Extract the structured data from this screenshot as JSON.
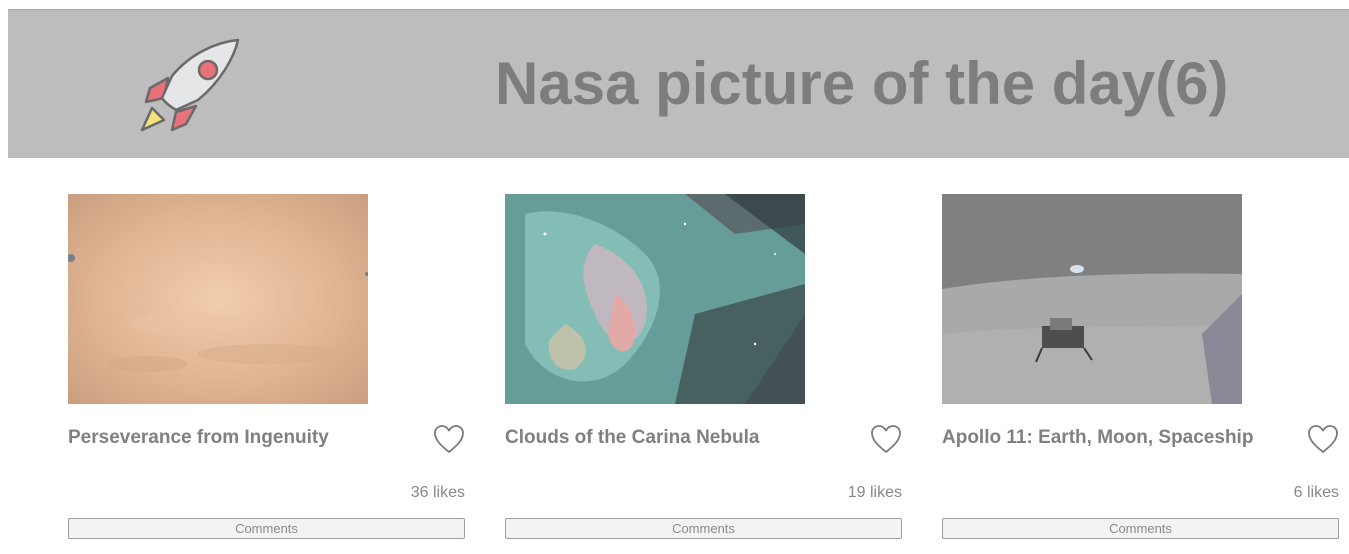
{
  "header": {
    "title": "Nasa picture of the day(6)",
    "logo_icon": "rocket-icon",
    "background": "#bdbdbd",
    "title_color": "#7d7d7d"
  },
  "cards": [
    {
      "title": "Perseverance from Ingenuity",
      "likes": "36 likes",
      "comments_label": "Comments",
      "image": "mars-surface-photo",
      "like_icon": "heart-outline-icon"
    },
    {
      "title": "Clouds of the Carina Nebula",
      "likes": "19 likes",
      "comments_label": "Comments",
      "image": "carina-nebula-photo",
      "like_icon": "heart-outline-icon"
    },
    {
      "title": "Apollo 11: Earth, Moon, Spaceship",
      "likes": "6 likes",
      "comments_label": "Comments",
      "image": "apollo-lunar-module-photo",
      "like_icon": "heart-outline-icon"
    }
  ]
}
